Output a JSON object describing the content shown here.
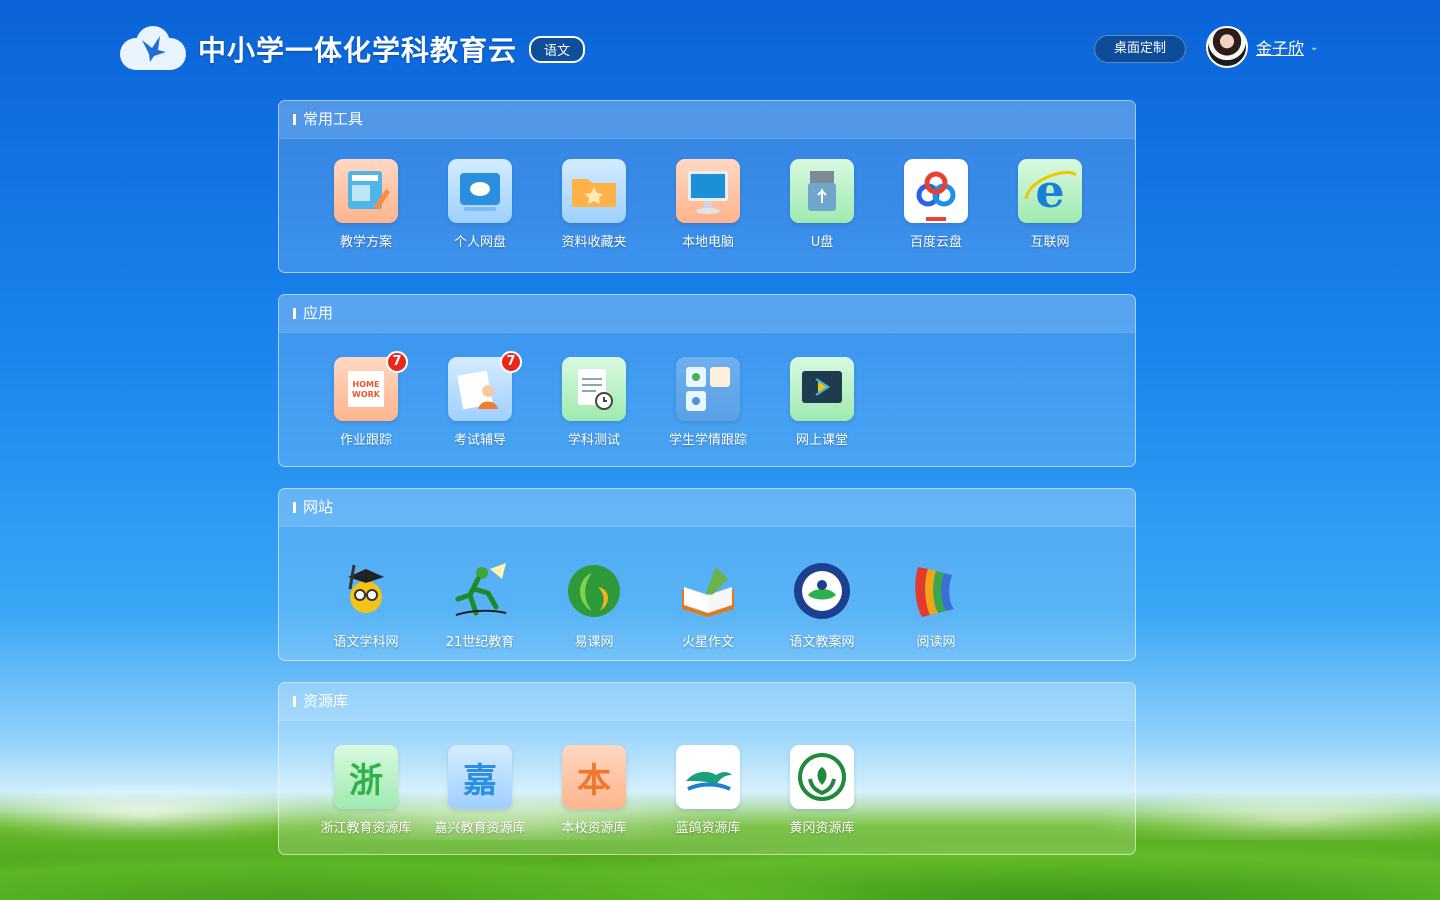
{
  "header": {
    "app_title": "中小学一体化学科教育云",
    "subject": "语文",
    "customize_label": "桌面定制",
    "user_name": "金子欣"
  },
  "sections": [
    {
      "title": "常用工具",
      "items": [
        {
          "label": "教学方案",
          "icon": "lesson-plan-icon"
        },
        {
          "label": "个人网盘",
          "icon": "personal-cloud-drive-icon"
        },
        {
          "label": "资料收藏夹",
          "icon": "favorites-folder-icon"
        },
        {
          "label": "本地电脑",
          "icon": "local-computer-icon"
        },
        {
          "label": "U盘",
          "icon": "usb-drive-icon"
        },
        {
          "label": "百度云盘",
          "icon": "baidu-cloud-icon"
        },
        {
          "label": "互联网",
          "icon": "internet-explorer-icon"
        }
      ]
    },
    {
      "title": "应用",
      "items": [
        {
          "label": "作业跟踪",
          "icon": "homework-icon",
          "badge": "7"
        },
        {
          "label": "考试辅导",
          "icon": "exam-tutoring-icon",
          "badge": "7"
        },
        {
          "label": "学科测试",
          "icon": "subject-test-icon"
        },
        {
          "label": "学生学情跟踪",
          "icon": "student-tracking-icon"
        },
        {
          "label": "网上课堂",
          "icon": "online-class-icon"
        }
      ]
    },
    {
      "title": "网站",
      "items": [
        {
          "label": "语文学科网",
          "icon": "chinese-subject-site-icon"
        },
        {
          "label": "21世纪教育",
          "icon": "21st-century-education-icon"
        },
        {
          "label": "易课网",
          "icon": "yike-site-icon"
        },
        {
          "label": "火星作文",
          "icon": "mars-composition-icon"
        },
        {
          "label": "语文教案网",
          "icon": "chinese-lesson-plan-site-icon"
        },
        {
          "label": "阅读网",
          "icon": "reading-site-icon"
        }
      ]
    },
    {
      "title": "资源库",
      "items": [
        {
          "label": "浙江教育资源库",
          "icon": "zhejiang-resource-icon",
          "char": "浙"
        },
        {
          "label": "嘉兴教育资源库",
          "icon": "jiaxing-resource-icon",
          "char": "嘉"
        },
        {
          "label": "本校资源库",
          "icon": "school-resource-icon",
          "char": "本"
        },
        {
          "label": "蓝鸽资源库",
          "icon": "languo-resource-icon"
        },
        {
          "label": "黄冈资源库",
          "icon": "huanggang-resource-icon"
        }
      ]
    }
  ]
}
